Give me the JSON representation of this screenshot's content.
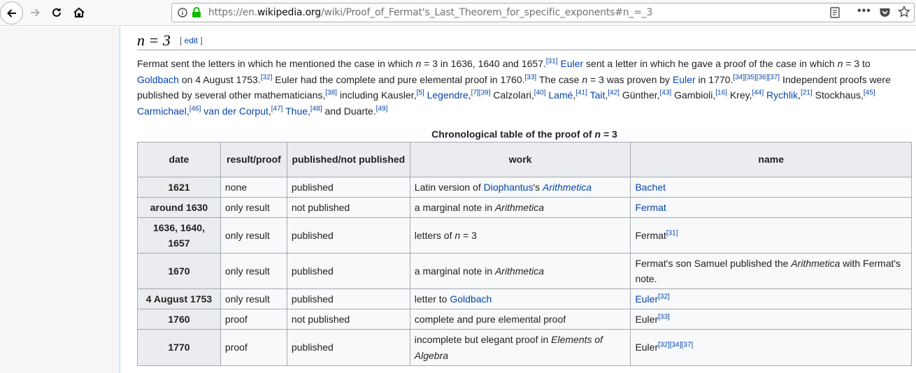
{
  "browser": {
    "url_prefix": "https://en.",
    "url_domain": "wikipedia.org",
    "url_path": "/wiki/Proof_of_Fermat's_Last_Theorem_for_specific_exponents#n_=_3",
    "more_label": "•••"
  },
  "section": {
    "title": "n = 3",
    "edit_open": "[ ",
    "edit_label": "edit",
    "edit_close": " ]"
  },
  "paragraph": {
    "s1": "Fermat sent the letters in which he mentioned the case in which ",
    "n1": "n",
    "s2": " = 3 in 1636, 1640 and 1657.",
    "r31": "[31]",
    "euler1": "Euler",
    "s3": " sent a letter in which he gave a proof of the case in which ",
    "n2": "n",
    "s4": " = 3 to ",
    "goldbach": "Goldbach",
    "s5": " on 4 August 1753.",
    "r32": "[32]",
    "s6": " Euler had the complete and pure elemental proof in 1760.",
    "r33": "[33]",
    "s7": " The case ",
    "n3": "n",
    "s8": " = 3 was proven by ",
    "euler2": "Euler",
    "s9": " in 1770.",
    "r34": "[34]",
    "r35": "[35]",
    "r36": "[36]",
    "r37": "[37]",
    "s10": " Independent proofs were published by several other mathematicians,",
    "r38": "[38]",
    "s11": " including Kausler,",
    "r5": "[5]",
    "legendre": "Legendre",
    "s12": ",",
    "r7": "[7]",
    "r39": "[39]",
    "s13": " Calzolari,",
    "r40": "[40]",
    "lame": "Lamé",
    "s14": ",",
    "r41": "[41]",
    "tait": "Tait",
    "s15": ",",
    "r42": "[42]",
    "s16": " Günther,",
    "r43": "[43]",
    "s17": " Gambioli,",
    "r16": "[16]",
    "s18": " Krey,",
    "r44": "[44]",
    "rychlik": "Rychlik",
    "s19": ",",
    "r21": "[21]",
    "s20": " Stockhaus,",
    "r45": "[45]",
    "carmichael": "Carmichael",
    "s21": ",",
    "r46": "[46]",
    "vandercorput": "van der Corput",
    "s22": ",",
    "r47": "[47]",
    "thue": "Thue",
    "s23": ",",
    "r48": "[48]",
    "s24": " and Duarte.",
    "r49": "[49]"
  },
  "table": {
    "caption_prefix": "Chronological table of the proof of ",
    "caption_n": "n",
    "caption_suffix": " = 3",
    "headers": [
      "date",
      "result/proof",
      "published/not published",
      "work",
      "name"
    ],
    "rows": [
      {
        "date": "1621",
        "result": "none",
        "published": "published",
        "w1": "Latin version of ",
        "wl": "Diophantus",
        "w2": "'s ",
        "wi": "Arithmetica",
        "w3": "",
        "name": "Bachet",
        "ref": ""
      },
      {
        "date": "around 1630",
        "result": "only result",
        "published": "not published",
        "w1": "a marginal note in ",
        "wi": "Arithmetica",
        "name": "Fermat"
      },
      {
        "date": "1636, 1640, 1657",
        "result": "only result",
        "published": "published",
        "w1": "letters of ",
        "wi": "n",
        "w3": " = 3",
        "name": "Fermat",
        "ref": "[31]"
      },
      {
        "date": "1670",
        "result": "only result",
        "published": "published",
        "w1": "a marginal note in ",
        "wi": "Arithmetica",
        "n1": "Fermat's son Samuel published the ",
        "ni": "Arithmetica",
        "n2": " with Fermat's note."
      },
      {
        "date": "4 August 1753",
        "result": "only result",
        "published": "published",
        "w1": "letter to ",
        "wl": "Goldbach",
        "name": "Euler",
        "ref": "[32]"
      },
      {
        "date": "1760",
        "result": "proof",
        "published": "not published",
        "w1": "complete and pure elemental proof",
        "name": "Euler",
        "ref": "[33]"
      },
      {
        "date": "1770",
        "result": "proof",
        "published": "published",
        "w1": "incomplete but elegant proof in ",
        "wi": "Elements of Algebra",
        "name": "Euler",
        "ref1": "[32]",
        "ref2": "[34]",
        "ref3": "[37]"
      }
    ]
  }
}
